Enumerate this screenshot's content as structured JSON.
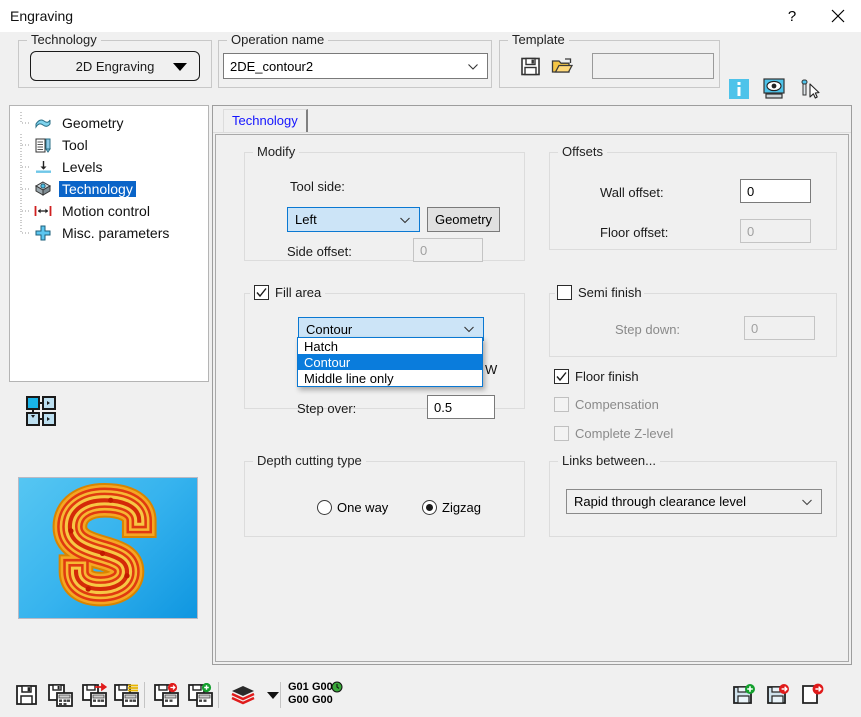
{
  "window": {
    "title": "Engraving",
    "help_label": "?",
    "close_label": "✕"
  },
  "topbar": {
    "technology_group": "Technology",
    "technology_value": "2D Engraving",
    "operation_group": "Operation name",
    "operation_value": "2DE_contour2",
    "template_group": "Template",
    "template_value": "",
    "template_save_icon": "save-icon",
    "template_open_icon": "open-folder-icon",
    "info_icon": "info-icon",
    "preview_icon": "eye-preview-icon",
    "pick_icon": "tool-pick-icon"
  },
  "tree": {
    "items": [
      {
        "label": "Geometry",
        "icon": "geometry-icon",
        "selected": false
      },
      {
        "label": "Tool",
        "icon": "tool-icon",
        "selected": false
      },
      {
        "label": "Levels",
        "icon": "levels-icon",
        "selected": false
      },
      {
        "label": "Technology",
        "icon": "technology-icon",
        "selected": true
      },
      {
        "label": "Motion control",
        "icon": "motion-control-icon",
        "selected": false
      },
      {
        "label": "Misc. parameters",
        "icon": "misc-parameters-icon",
        "selected": false
      }
    ],
    "mini_icon": "toolpath-diagram-icon"
  },
  "preview": {
    "icon": "engraving-preview-letter-s"
  },
  "panel": {
    "tab_label": "Technology",
    "modify": {
      "group": "Modify",
      "tool_side_label": "Tool side:",
      "tool_side_value": "Left",
      "geometry_button": "Geometry",
      "side_offset_label": "Side offset:",
      "side_offset_value": "0"
    },
    "fill_area": {
      "checkbox_label": "Fill area",
      "checked": true,
      "mode_value": "Contour",
      "options": [
        "Hatch",
        "Contour",
        "Middle line only"
      ],
      "selected_option_index": 1,
      "clipped_label": "W",
      "step_over_label": "Step over:",
      "step_over_value": "0.5"
    },
    "depth_cutting": {
      "group": "Depth cutting type",
      "options": [
        {
          "label": "One way",
          "selected": false
        },
        {
          "label": "Zigzag",
          "selected": true
        }
      ]
    },
    "offsets": {
      "group": "Offsets",
      "wall_offset_label": "Wall offset:",
      "wall_offset_value": "0",
      "floor_offset_label": "Floor offset:",
      "floor_offset_value": "0"
    },
    "semi_finish": {
      "checkbox_label": "Semi finish",
      "checked": false,
      "step_down_label": "Step down:",
      "step_down_value": "0"
    },
    "floor_finish": {
      "checkbox_label": "Floor finish",
      "checked": true,
      "compensation_label": "Compensation",
      "compensation_checked": false,
      "complete_z_label": "Complete Z-level",
      "complete_z_checked": false
    },
    "links": {
      "group": "Links between...",
      "value": "Rapid through clearance level"
    }
  },
  "bottom_toolbar": {
    "left_items": [
      {
        "name": "save-icon"
      },
      {
        "name": "save-calc-icon"
      },
      {
        "name": "save-calc-export-icon"
      },
      {
        "name": "save-calc-list-icon"
      },
      {
        "name": "save-calc-delete-icon"
      },
      {
        "name": "save-calc-add-icon"
      },
      {
        "name": "layers-icon"
      },
      {
        "name": "layers-dropdown-arrow-icon"
      }
    ],
    "gcode_1": {
      "line1": "G01",
      "line2": "G00"
    },
    "gcode_2": {
      "line1": "G00",
      "line2": "G00"
    },
    "right_items": [
      {
        "name": "save-add-icon"
      },
      {
        "name": "save-delete-icon"
      },
      {
        "name": "close-delete-icon"
      }
    ]
  }
}
